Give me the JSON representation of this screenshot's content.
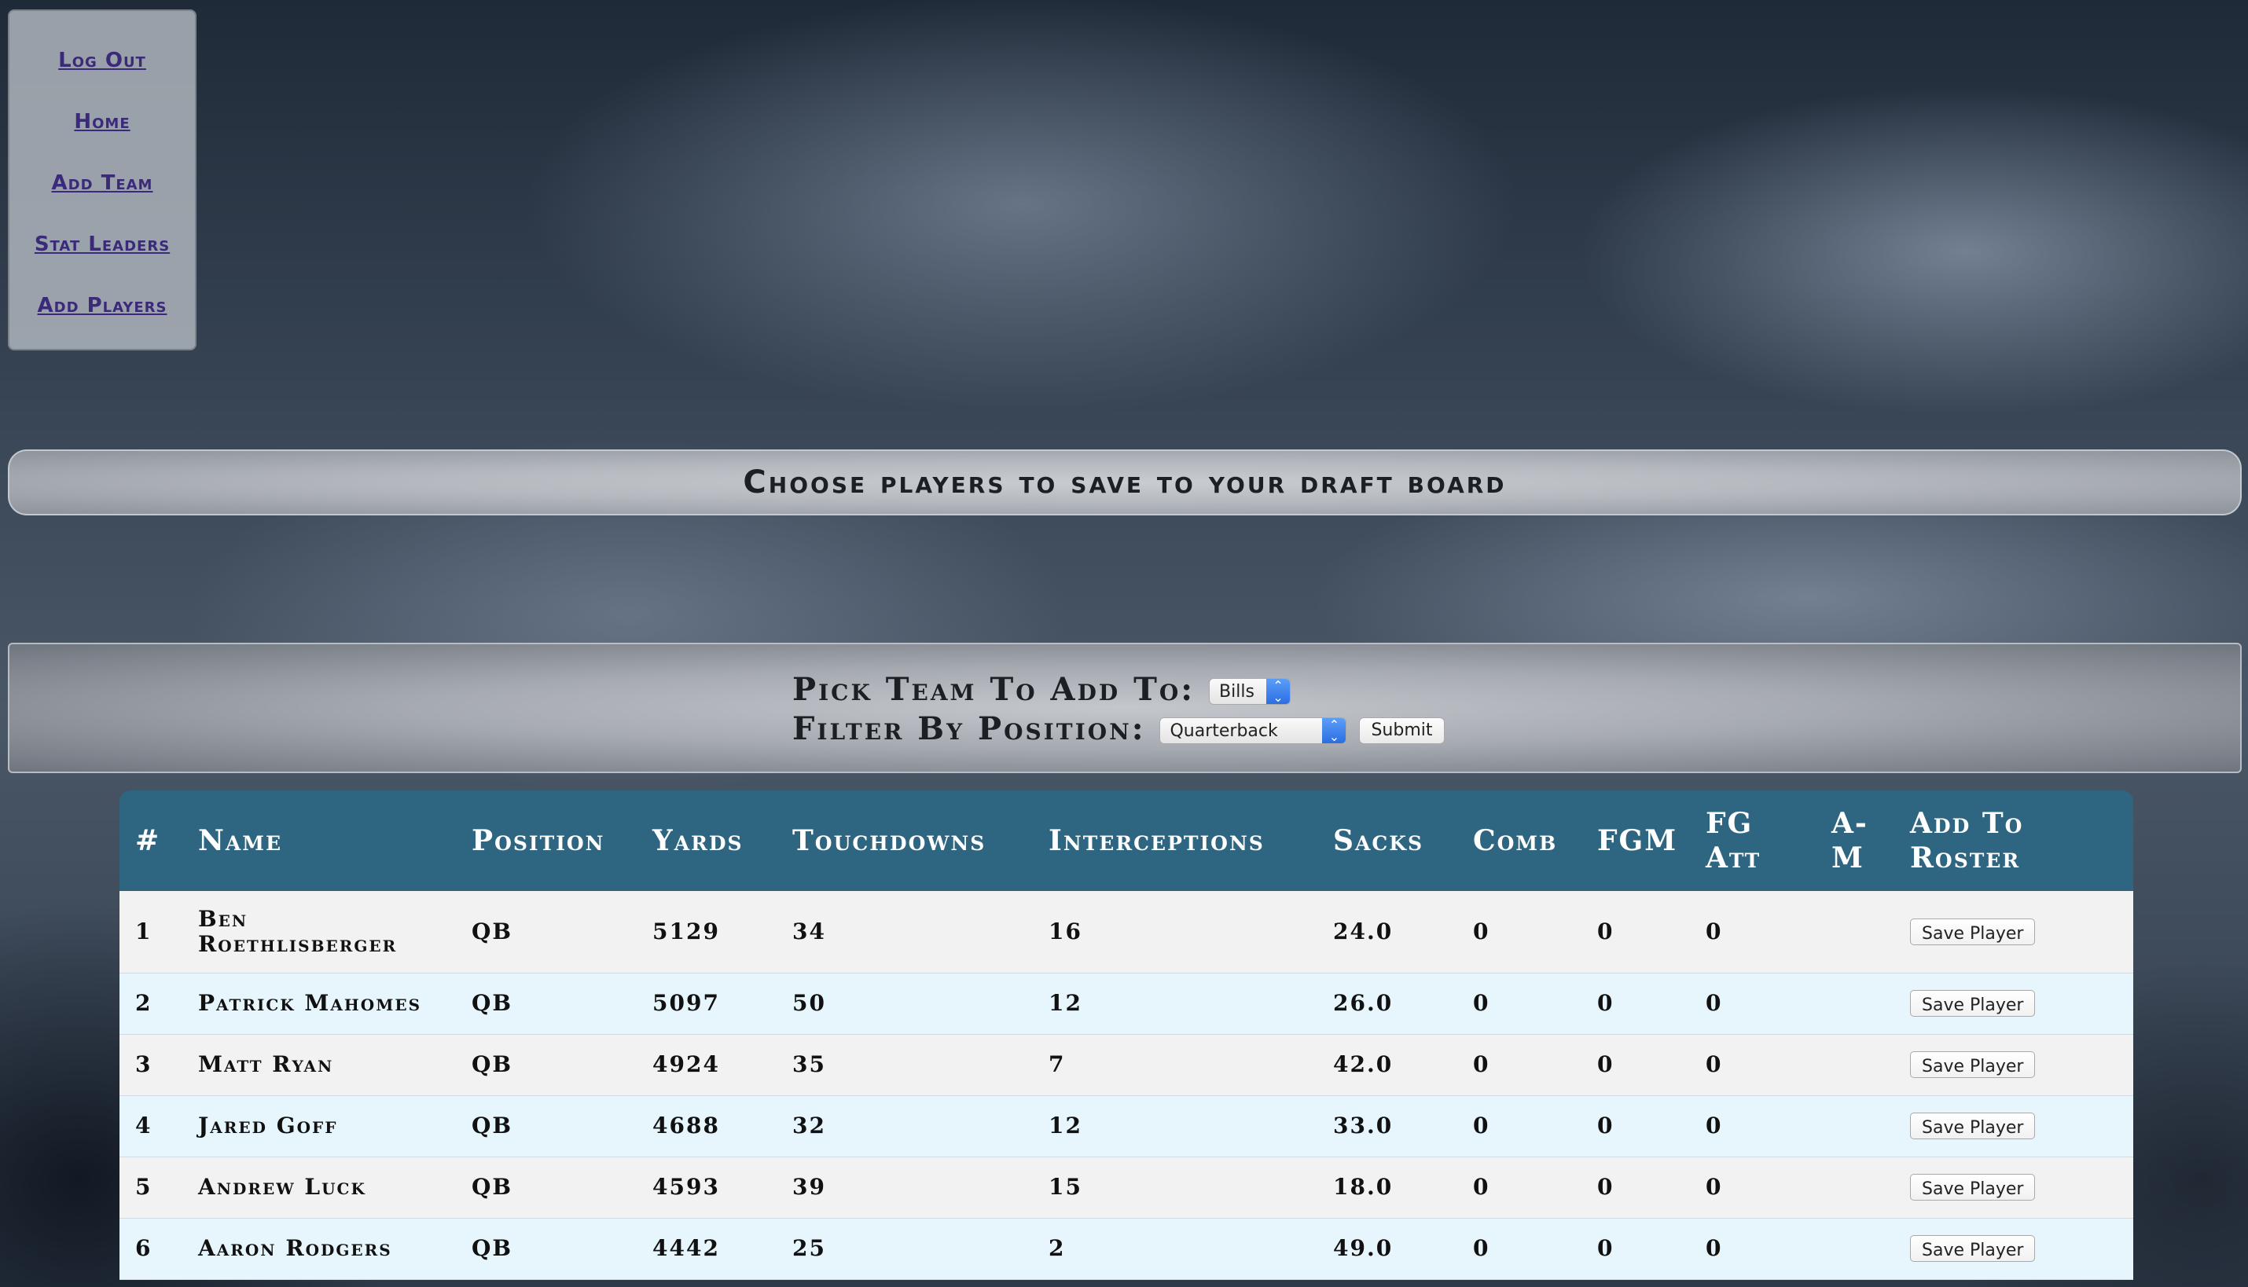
{
  "nav": {
    "items": [
      {
        "label": "Log Out"
      },
      {
        "label": "Home"
      },
      {
        "label": "Add Team"
      },
      {
        "label": "Stat Leaders"
      },
      {
        "label": "Add Players"
      }
    ]
  },
  "banner": {
    "title": "Choose players to save to your draft board"
  },
  "form": {
    "team_label": "Pick Team To Add To:",
    "team_value": "Bills",
    "position_label": "Filter By Position:",
    "position_value": "Quarterback",
    "submit_label": "Submit"
  },
  "table": {
    "headers": {
      "num": "#",
      "name": "Name",
      "position": "Position",
      "yards": "Yards",
      "touchdowns": "Touchdowns",
      "interceptions": "Interceptions",
      "sacks": "Sacks",
      "comb": "Comb",
      "fgm": "FGM",
      "fgatt": "FG Att",
      "am": "A-M",
      "add": "Add To Roster"
    },
    "save_label": "Save Player",
    "rows": [
      {
        "num": "1",
        "name": "Ben Roethlisberger",
        "position": "QB",
        "yards": "5129",
        "touchdowns": "34",
        "interceptions": "16",
        "sacks": "24.0",
        "comb": "0",
        "fgm": "0",
        "fgatt": "0",
        "am": ""
      },
      {
        "num": "2",
        "name": "Patrick Mahomes",
        "position": "QB",
        "yards": "5097",
        "touchdowns": "50",
        "interceptions": "12",
        "sacks": "26.0",
        "comb": "0",
        "fgm": "0",
        "fgatt": "0",
        "am": ""
      },
      {
        "num": "3",
        "name": "Matt Ryan",
        "position": "QB",
        "yards": "4924",
        "touchdowns": "35",
        "interceptions": "7",
        "sacks": "42.0",
        "comb": "0",
        "fgm": "0",
        "fgatt": "0",
        "am": ""
      },
      {
        "num": "4",
        "name": "Jared Goff",
        "position": "QB",
        "yards": "4688",
        "touchdowns": "32",
        "interceptions": "12",
        "sacks": "33.0",
        "comb": "0",
        "fgm": "0",
        "fgatt": "0",
        "am": ""
      },
      {
        "num": "5",
        "name": "Andrew Luck",
        "position": "QB",
        "yards": "4593",
        "touchdowns": "39",
        "interceptions": "15",
        "sacks": "18.0",
        "comb": "0",
        "fgm": "0",
        "fgatt": "0",
        "am": ""
      },
      {
        "num": "6",
        "name": "Aaron Rodgers",
        "position": "QB",
        "yards": "4442",
        "touchdowns": "25",
        "interceptions": "2",
        "sacks": "49.0",
        "comb": "0",
        "fgm": "0",
        "fgatt": "0",
        "am": ""
      }
    ]
  }
}
